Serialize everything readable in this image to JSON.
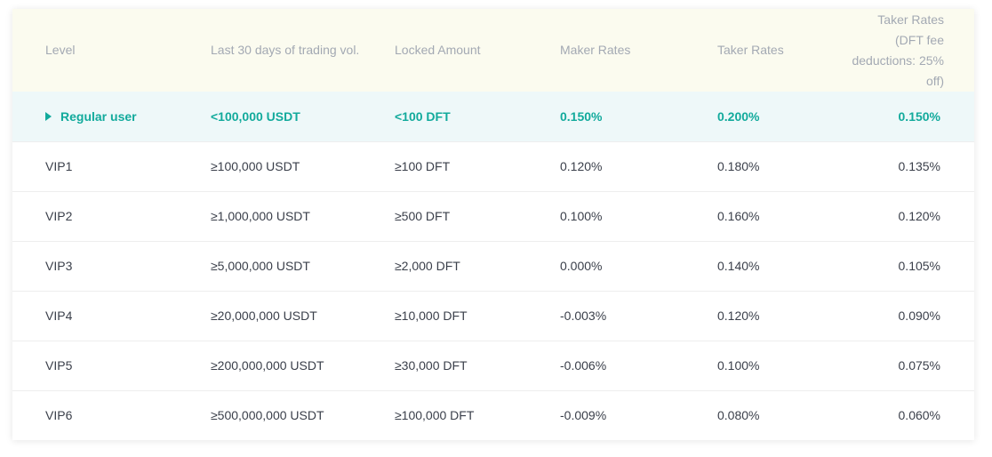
{
  "table": {
    "headers": {
      "level": "Level",
      "volume": "Last 30 days of trading vol.",
      "locked": "Locked Amount",
      "maker": "Maker Rates",
      "taker": "Taker Rates",
      "taker_dft_lines": [
        "Taker Rates",
        "(DFT fee",
        "deductions: 25%",
        "off)"
      ]
    },
    "rows": [
      {
        "level": "Regular user",
        "volume": "<100,000 USDT",
        "locked": "<100 DFT",
        "maker": "0.150%",
        "taker": "0.200%",
        "taker_dft": "0.150%"
      },
      {
        "level": "VIP1",
        "volume": "≥100,000 USDT",
        "locked": "≥100 DFT",
        "maker": "0.120%",
        "taker": "0.180%",
        "taker_dft": "0.135%"
      },
      {
        "level": "VIP2",
        "volume": "≥1,000,000 USDT",
        "locked": "≥500 DFT",
        "maker": "0.100%",
        "taker": "0.160%",
        "taker_dft": "0.120%"
      },
      {
        "level": "VIP3",
        "volume": "≥5,000,000 USDT",
        "locked": "≥2,000 DFT",
        "maker": "0.000%",
        "taker": "0.140%",
        "taker_dft": "0.105%"
      },
      {
        "level": "VIP4",
        "volume": "≥20,000,000 USDT",
        "locked": "≥10,000 DFT",
        "maker": "-0.003%",
        "taker": "0.120%",
        "taker_dft": "0.090%"
      },
      {
        "level": "VIP5",
        "volume": "≥200,000,000 USDT",
        "locked": "≥30,000 DFT",
        "maker": "-0.006%",
        "taker": "0.100%",
        "taker_dft": "0.075%"
      },
      {
        "level": "VIP6",
        "volume": "≥500,000,000 USDT",
        "locked": "≥100,000 DFT",
        "maker": "-0.009%",
        "taker": "0.080%",
        "taker_dft": "0.060%"
      }
    ],
    "current_row_index": 0
  },
  "colors": {
    "accent": "#12aa9c",
    "header_bg": "#fbfbef",
    "highlight_bg": "#eef8f9",
    "header_text": "#a3a9b3",
    "body_text": "#3a3f4a"
  },
  "icons": {
    "current_level_marker": "caret-right-icon"
  }
}
